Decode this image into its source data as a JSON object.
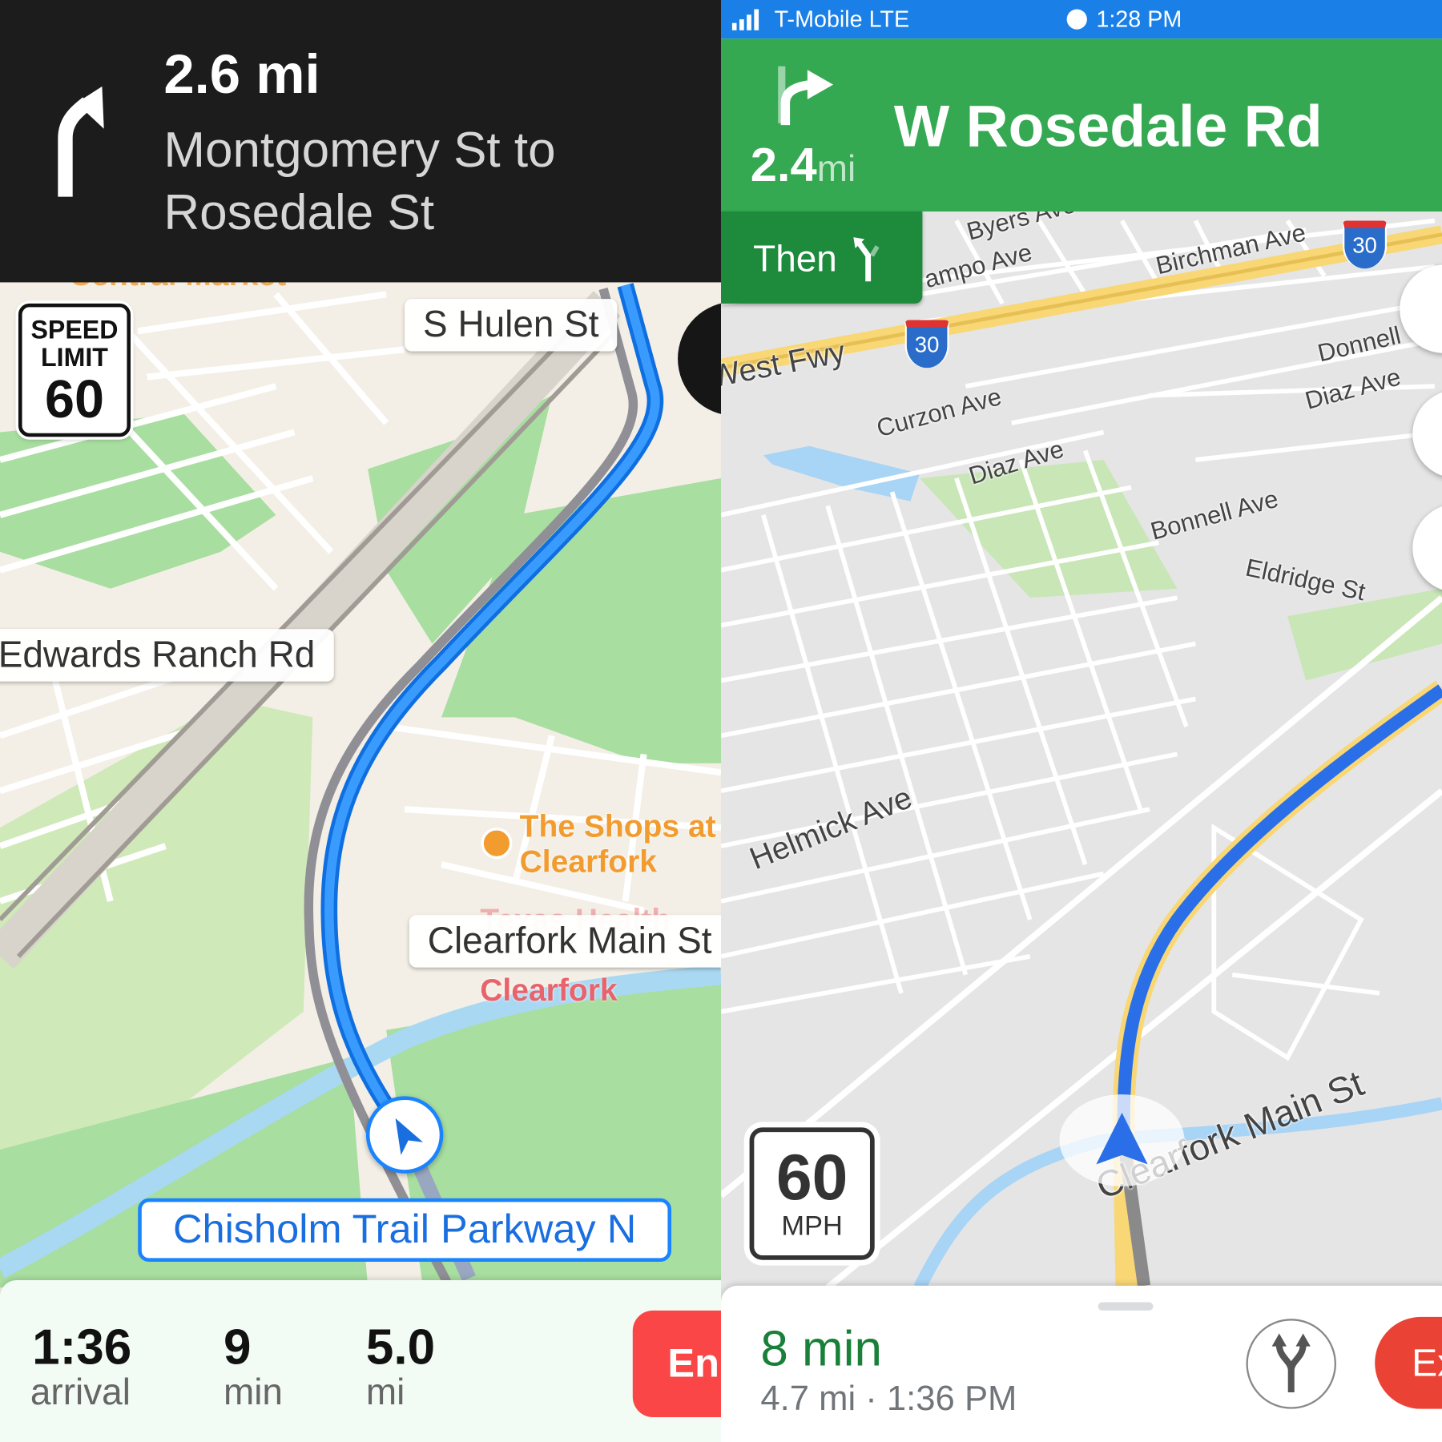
{
  "left": {
    "banner": {
      "distance": "2.6 mi",
      "instruction_line1": "Montgomery St to",
      "instruction_line2": "Rosedale St",
      "maneuver_icon": "slight-right-arrow-icon"
    },
    "speed_limit": {
      "line1": "SPEED",
      "line2": "LIMIT",
      "value": "60"
    },
    "map_labels": {
      "central_market": "Central Market",
      "s_hulen": "S Hulen St",
      "edwards_ranch": "Edwards Ranch Rd",
      "shops_line1": "The Shops at",
      "shops_line2": "Clearfork",
      "texas_health": "Texas Health",
      "clearfork_main": "Clearfork Main St",
      "clearfork_red": "Clearfork",
      "current_road": "Chisholm Trail Parkway N"
    },
    "trip": {
      "arrival_value": "1:36",
      "arrival_label": "arrival",
      "time_value": "9",
      "time_label": "min",
      "distance_value": "5.0",
      "distance_label": "mi",
      "end_button": "End"
    },
    "colors": {
      "route": "#1a84ff",
      "end": "#fa4646",
      "header": "#1c1c1c"
    }
  },
  "right": {
    "status_bar": {
      "carrier": "T-Mobile LTE",
      "time": "1:28 PM"
    },
    "banner": {
      "distance_value": "2.4",
      "distance_unit": "mi",
      "street": "W Rosedale Rd",
      "maneuver_icon": "turn-right-arrow-icon"
    },
    "then": {
      "label": "Then",
      "icon": "slight-left-arrow-icon"
    },
    "map_labels": {
      "byers": "Byers Ave",
      "campo": "ampo Ave",
      "birchman": "Birchman Ave",
      "west_fwy": "West Fwy",
      "curzon": "Curzon Ave",
      "diaz1": "Diaz Ave",
      "donnell": "Donnell",
      "diaz2": "Diaz Ave",
      "bonnell": "Bonnell Ave",
      "eldridge": "Eldridge St",
      "helmick": "Helmick Ave",
      "clearfork_main": "Clearfork Main St",
      "i30_a": "30",
      "i30_b": "30"
    },
    "speed_sign": {
      "value": "60",
      "unit": "MPH"
    },
    "trip": {
      "eta": "8 min",
      "details": "4.7 mi · 1:36 PM",
      "exit_button": "Exit"
    },
    "colors": {
      "status": "#1a80e8",
      "banner": "#35a852",
      "then": "#1e8a3c",
      "eta": "#188038",
      "exit": "#ea4335"
    }
  }
}
